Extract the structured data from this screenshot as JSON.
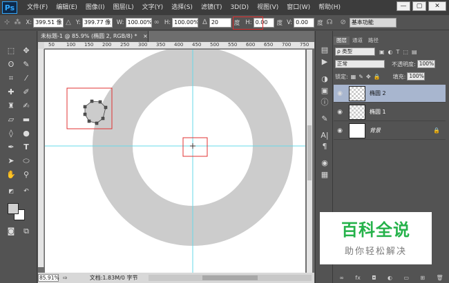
{
  "app": {
    "logo": "Ps",
    "menu": [
      "文件(F)",
      "编辑(E)",
      "图像(I)",
      "图层(L)",
      "文字(Y)",
      "选择(S)",
      "滤镜(T)",
      "3D(D)",
      "视图(V)",
      "窗口(W)",
      "帮助(H)"
    ],
    "window_controls": [
      "—",
      "▢",
      "✕"
    ]
  },
  "options": {
    "x_label": "X:",
    "x_value": "399.51 像",
    "y_label": "Y:",
    "y_value": "399.77 像",
    "w_label": "W:",
    "w_value": "100.00%",
    "h_label": "H:",
    "h_value": "100.00%",
    "angle_value": "20",
    "angle_unit": "度",
    "hskew_label": "H:",
    "hskew_value": "0.00",
    "hskew_unit": "度",
    "vskew_label": "V:",
    "vskew_value": "0.00",
    "vskew_unit": "度",
    "workspace": "基本功能"
  },
  "document": {
    "tab_title": "未标题-1 @ 85.9% (椭圆 2, RGB/8) *",
    "tab_close": "×",
    "ruler_ticks": [
      "50",
      "100",
      "150",
      "200",
      "250",
      "300",
      "350",
      "400",
      "450",
      "500",
      "550",
      "600",
      "650",
      "700",
      "750"
    ],
    "zoom": "85.91%",
    "doc_info": "文档:1.83M/0 字节"
  },
  "layers_panel": {
    "tabs": [
      "图层",
      "通道",
      "路径"
    ],
    "filter_kind": "ρ 类型",
    "blend_mode": "正常",
    "opacity_label": "不透明度:",
    "opacity_value": "100%",
    "lock_label": "锁定:",
    "fill_label": "填充:",
    "fill_value": "100%",
    "layers": [
      {
        "name": "椭圆 2",
        "selected": true
      },
      {
        "name": "椭圆 1",
        "selected": false
      },
      {
        "name": "背景",
        "selected": false
      }
    ],
    "footer_icons": [
      "link-icon",
      "fx-icon",
      "mask-icon",
      "adjustment-icon",
      "folder-icon",
      "new-layer-icon",
      "trash-icon"
    ]
  },
  "watermark": {
    "title": "百科全说",
    "subtitle": "助你轻松解决"
  },
  "colors": {
    "ring": "#cccccc",
    "guide": "#66d9e8",
    "highlight": "#e03030",
    "watermark_green": "#25b24a"
  }
}
